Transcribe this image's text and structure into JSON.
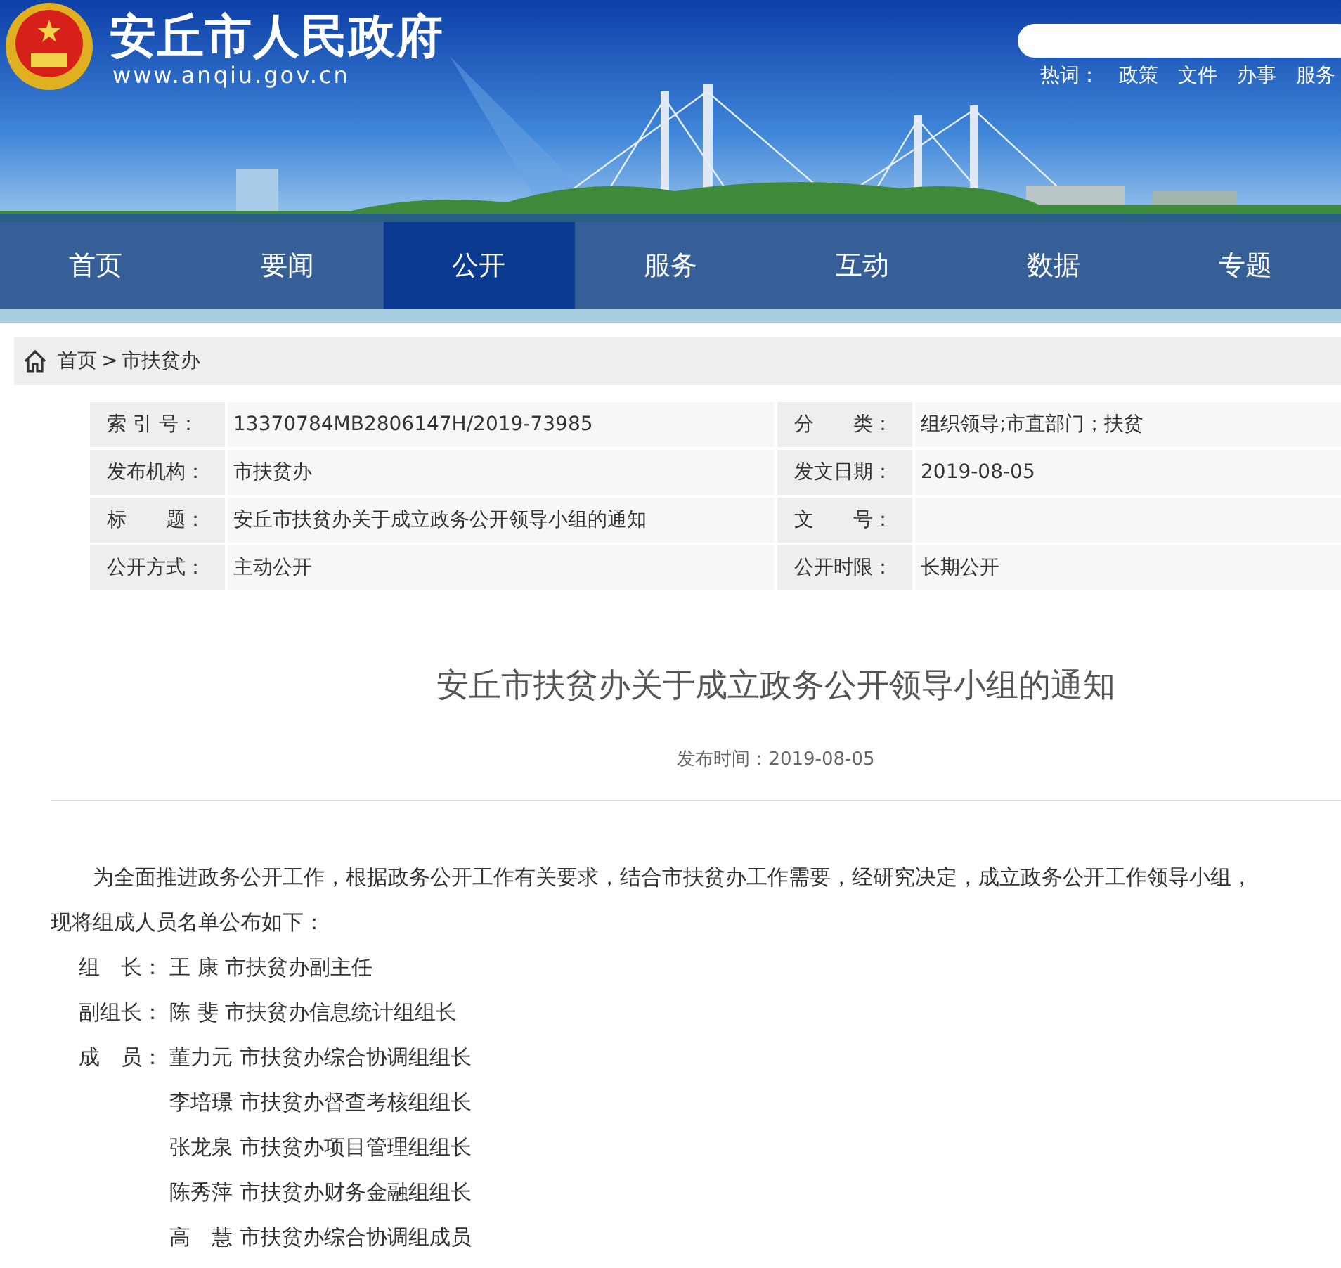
{
  "header": {
    "site_title": "安丘市人民政府",
    "site_url": "www.anqiu.gov.cn",
    "hot_label": "热词：",
    "hot_words": [
      "政策",
      "文件",
      "办事",
      "服务"
    ]
  },
  "nav": [
    {
      "label": "首页",
      "selected": false
    },
    {
      "label": "要闻",
      "selected": false
    },
    {
      "label": "公开",
      "selected": true
    },
    {
      "label": "服务",
      "selected": false
    },
    {
      "label": "互动",
      "selected": false
    },
    {
      "label": "数据",
      "selected": false
    },
    {
      "label": "专题",
      "selected": false
    }
  ],
  "breadcrumb": {
    "items": [
      "首页",
      "市扶贫办"
    ],
    "separator": ">"
  },
  "info_table": [
    [
      {
        "label": "索 引 号：",
        "value": "13370784MB2806147H/2019-73985"
      },
      {
        "label": "分　　类：",
        "value": "组织领导;市直部门；扶贫"
      }
    ],
    [
      {
        "label": "发布机构：",
        "value": "市扶贫办"
      },
      {
        "label": "发文日期：",
        "value": "2019-08-05"
      }
    ],
    [
      {
        "label": "标　　题：",
        "value": "安丘市扶贫办关于成立政务公开领导小组的通知"
      },
      {
        "label": "文　　号："
      }
    ],
    [
      {
        "label": "公开方式：",
        "value": "主动公开"
      },
      {
        "label": "公开时限：",
        "value": "长期公开"
      }
    ]
  ],
  "article": {
    "title": "安丘市扶贫办关于成立政务公开领导小组的通知",
    "published": "发布时间：2019-08-05",
    "paragraph": "为全面推进政务公开工作，根据政务公开工作有关要求，结合市扶贫办工作需要，经研究决定，成立政务公开工作领导小组，现将组成人员名单公布如下：",
    "members": [
      {
        "role": "组　长：",
        "text": "王 康 市扶贫办副主任"
      },
      {
        "role": "副组长：",
        "text": "陈 斐 市扶贫办信息统计组组长"
      },
      {
        "role": "成　员：",
        "text": "董力元 市扶贫办综合协调组组长"
      },
      {
        "text": "李培璟 市扶贫办督查考核组组长"
      },
      {
        "text": "张龙泉 市扶贫办项目管理组组长"
      },
      {
        "text": "陈秀萍 市扶贫办财务金融组组长"
      },
      {
        "text": "高　慧 市扶贫办综合协调组成员"
      }
    ]
  }
}
